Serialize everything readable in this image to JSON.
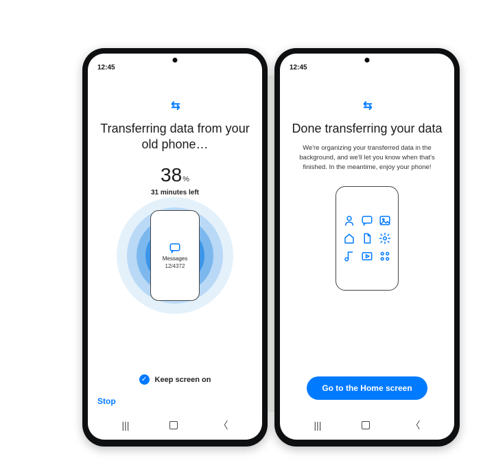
{
  "status_time": "12:45",
  "left": {
    "title": "Transferring data from your old phone…",
    "percent": "38",
    "percent_symbol": "%",
    "eta": "31 minutes left",
    "current_item_label": "Messages",
    "current_item_count": "12/4372",
    "keep_screen_label": "Keep screen on",
    "stop_label": "Stop"
  },
  "right": {
    "title": "Done transferring your data",
    "subtitle": "We're organizing your transferred data in the background, and we'll let you know when that's finished. In the meantime, enjoy your phone!",
    "cta": "Go to the Home screen"
  }
}
